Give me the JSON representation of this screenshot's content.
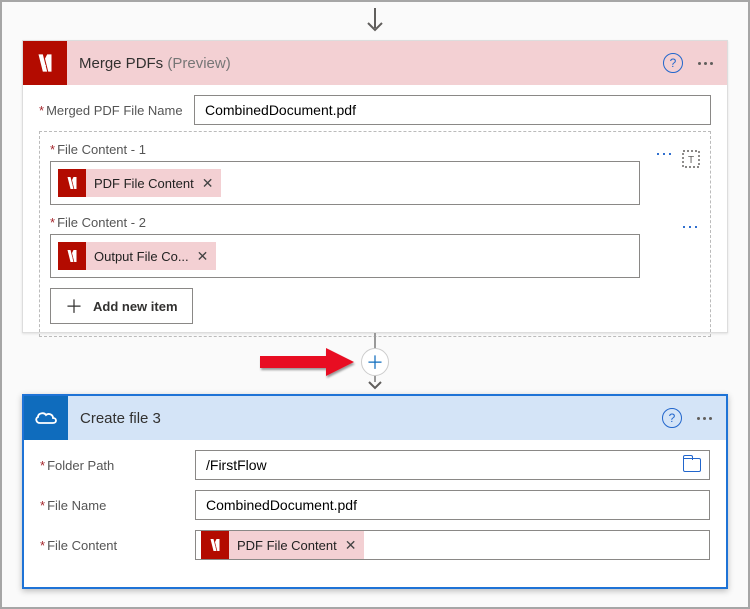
{
  "card1": {
    "title": "Merge PDFs",
    "title_suffix": "(Preview)",
    "field_merged_name_label": "Merged PDF File Name",
    "field_merged_name_value": "CombinedDocument.pdf",
    "file_content_1_label": "File Content - 1",
    "token1_text": "PDF File Content",
    "file_content_2_label": "File Content - 2",
    "token2_text": "Output File Co...",
    "add_new_item": "Add new item"
  },
  "card2": {
    "title": "Create file 3",
    "folder_path_label": "Folder Path",
    "folder_path_value": "/FirstFlow",
    "file_name_label": "File Name",
    "file_name_value": "CombinedDocument.pdf",
    "file_content_label": "File Content",
    "token_text": "PDF File Content"
  }
}
